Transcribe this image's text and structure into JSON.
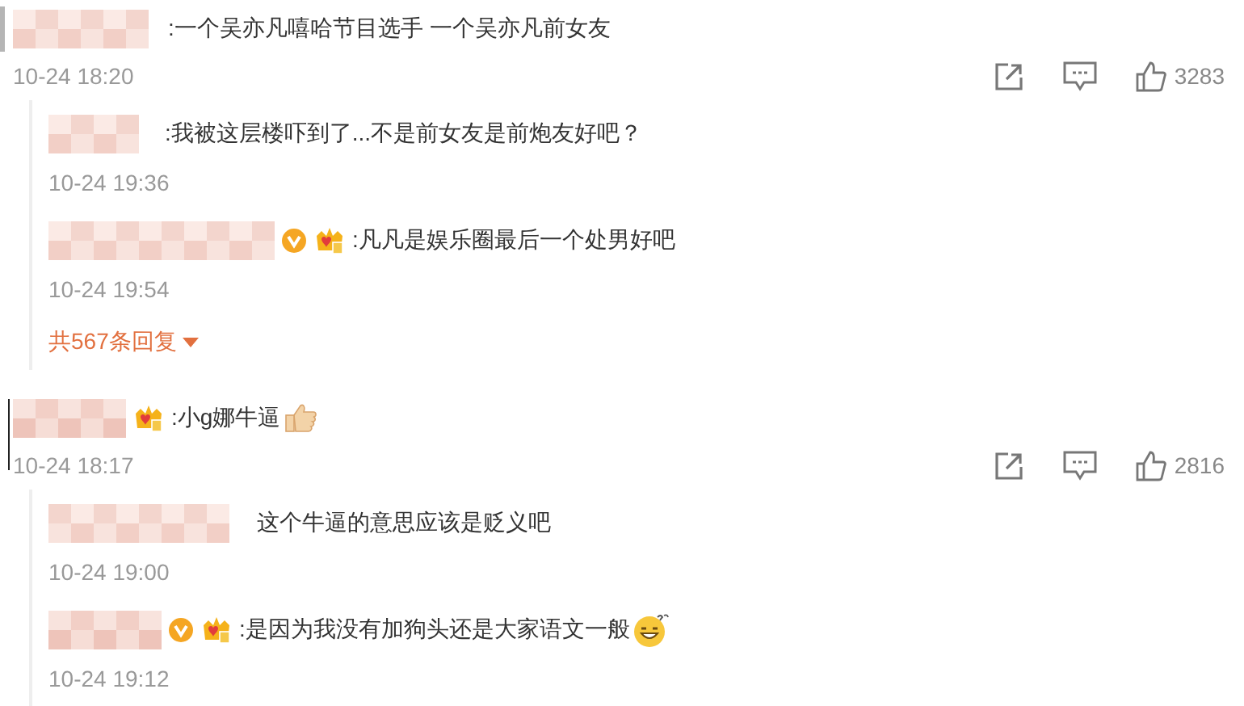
{
  "comments": [
    {
      "verified": false,
      "crown": false,
      "text": ":一个吴亦凡嘻哈节目选手 一个吴亦凡前女友",
      "time": "10-24 18:20",
      "likes": "3283",
      "replies": [
        {
          "verified": false,
          "crown": false,
          "text": ":我被这层楼吓到了...不是前女友是前炮友好吧？",
          "time": "10-24 19:36"
        },
        {
          "verified": true,
          "crown": true,
          "text": ":凡凡是娱乐圈最后一个处男好吧",
          "time": "10-24 19:54"
        }
      ],
      "more_replies": "共567条回复"
    },
    {
      "verified": false,
      "crown": true,
      "text": ":小g娜牛逼",
      "emoji": {
        "kind": "thumbs_up"
      },
      "time": "10-24 18:17",
      "likes": "2816",
      "replies": [
        {
          "verified": false,
          "crown": false,
          "text": "这个牛逼的意思应该是贬义吧",
          "time": "10-24 19:00"
        },
        {
          "verified": true,
          "crown": true,
          "text": ":是因为我没有加狗头还是大家语文一般",
          "emoji": {
            "kind": "grin"
          },
          "time": "10-24 19:12"
        }
      ]
    }
  ]
}
